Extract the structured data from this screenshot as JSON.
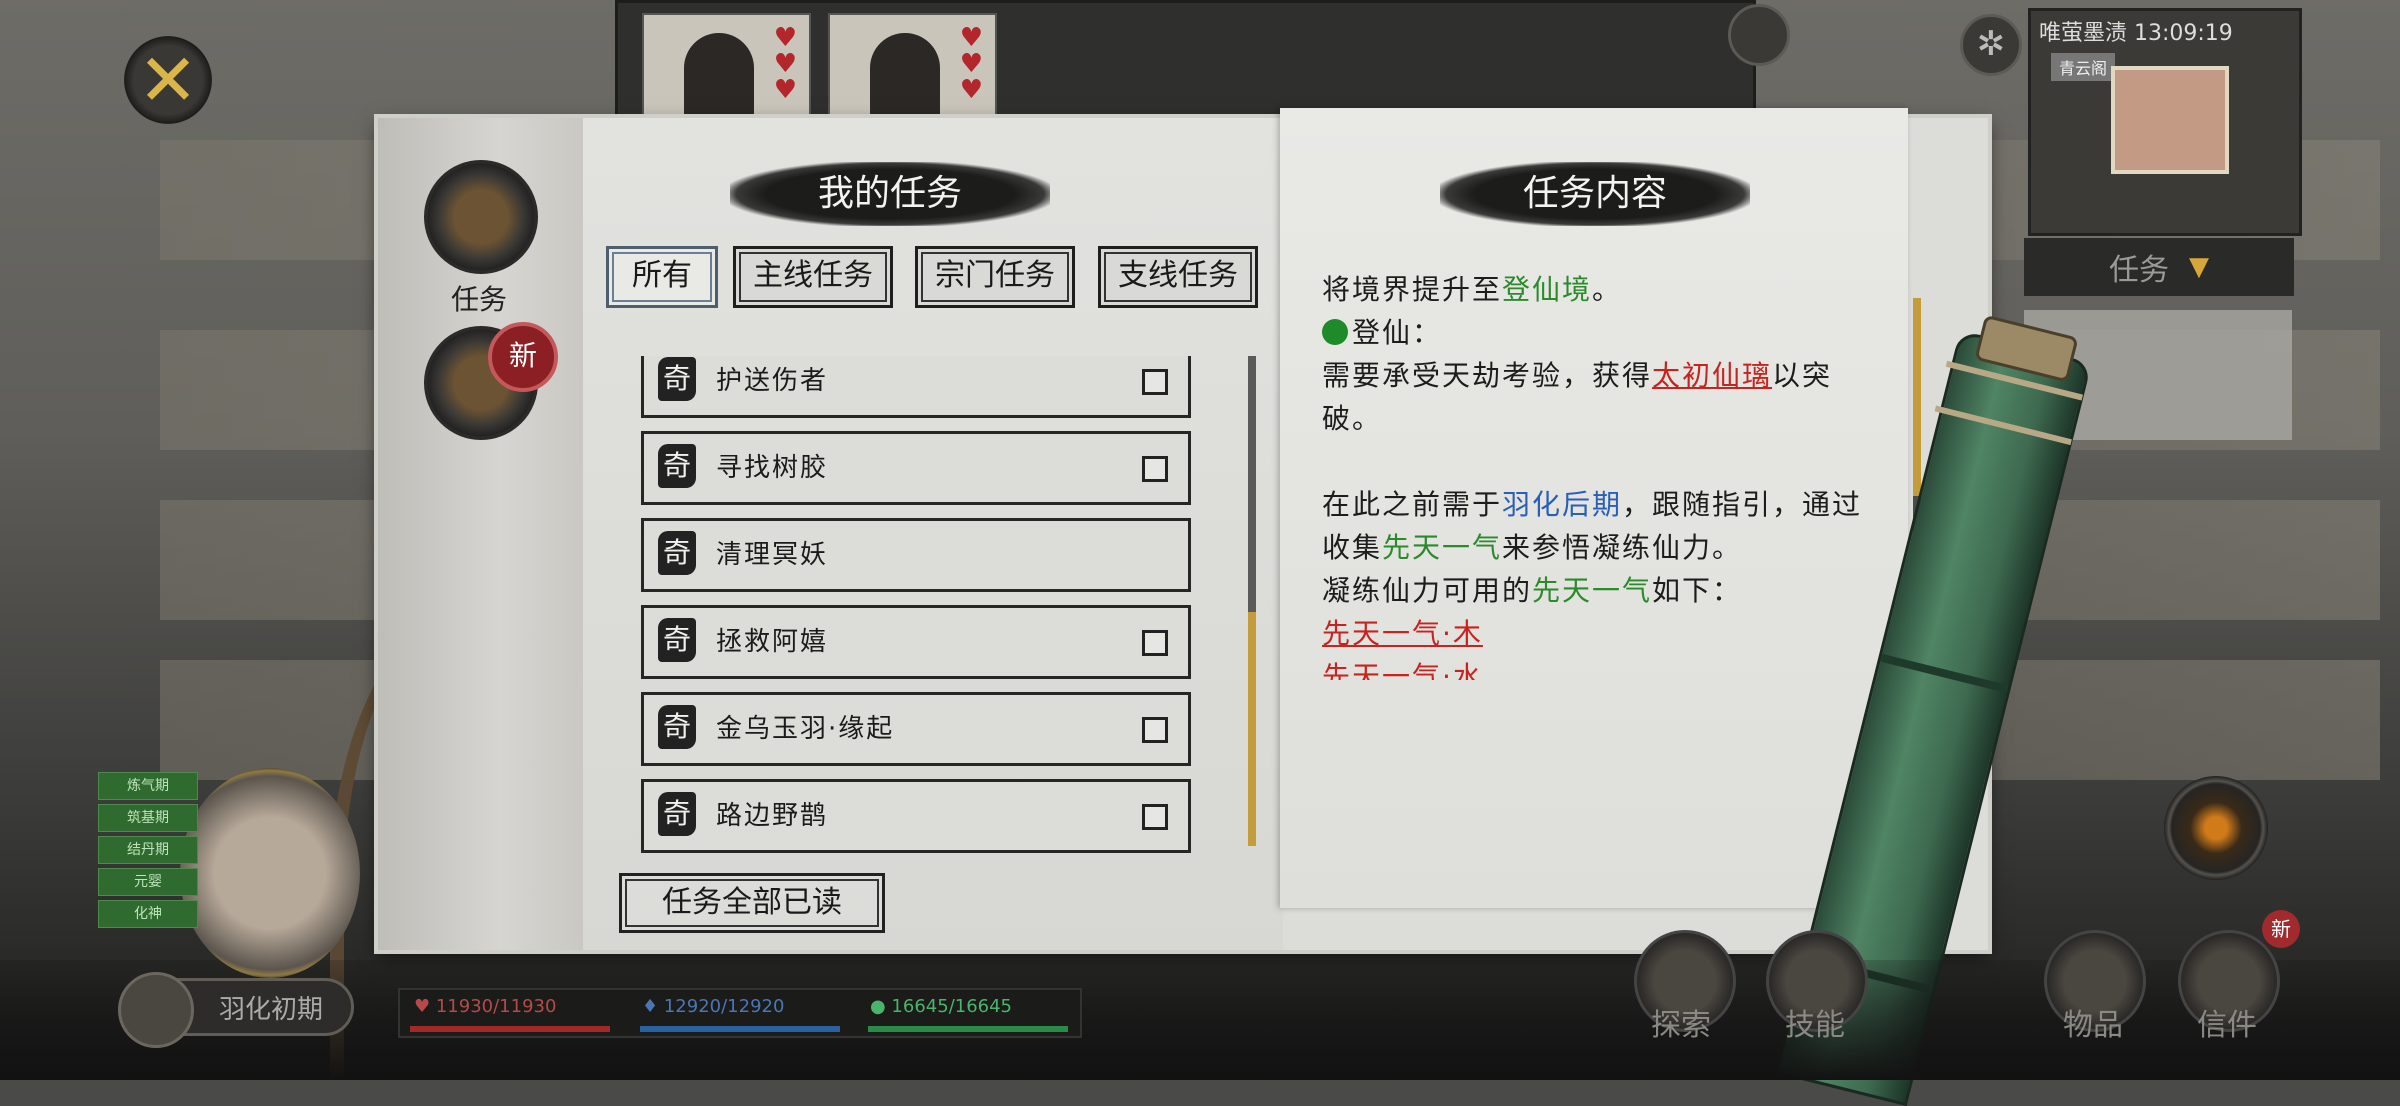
{
  "close_label": "✕",
  "top": {
    "minimap_clock": "唯萤墨渍 13:09:19",
    "minimap_location": "青云阁"
  },
  "task_dropdown": "任务",
  "sidebar": {
    "task_label": "任务",
    "new_badge": "新"
  },
  "left_page": {
    "title": "我的任务",
    "tabs": [
      "所有",
      "主线任务",
      "宗门任务",
      "支线任务"
    ],
    "active_tab": "所有",
    "tasks": [
      {
        "tag": "奇",
        "name": "护送伤者",
        "checkbox": true
      },
      {
        "tag": "奇",
        "name": "寻找树胶",
        "checkbox": true
      },
      {
        "tag": "奇",
        "name": "清理冥妖",
        "checkbox": false
      },
      {
        "tag": "奇",
        "name": "拯救阿嬉",
        "checkbox": true
      },
      {
        "tag": "奇",
        "name": "金乌玉羽·缘起",
        "checkbox": true
      },
      {
        "tag": "奇",
        "name": "路边野鹊",
        "checkbox": true
      }
    ],
    "read_all_button": "任务全部已读"
  },
  "right_page": {
    "title": "任务内容",
    "line1_pre": "将境界提升至",
    "line1_hl": "登仙境",
    "line1_post": "。",
    "line2": "登仙：",
    "line3_pre": "需要承受天劫考验，获得",
    "line3_hl": "太初仙璃",
    "line3_post": "以突破。",
    "line4_pre": "在此之前需于",
    "line4_hl": "羽化后期",
    "line4_post": "，跟随指引，通过",
    "line5_pre": "收集",
    "line5_hl": "先天一气",
    "line5_post": "来参悟凝练仙力。",
    "line6_pre": "凝练仙力可用的",
    "line6_hl": "先天一气",
    "line6_post": "如下：",
    "line7": "先天一气·木",
    "line8": "先天一气·水"
  },
  "hud": {
    "status_buttons": [
      "炼气期",
      "筑基期",
      "结丹期",
      "元婴",
      "化神"
    ],
    "realm": "羽化初期",
    "hp": "♥ 11930/11930",
    "mp": "♦ 12920/12920",
    "sp": "● 16645/16645",
    "nav": [
      "探索",
      "技能",
      "物品",
      "信件"
    ],
    "mail_badge": "新"
  },
  "colors": {
    "accent_gold": "#c39c3c",
    "green_text": "#2c8a2c",
    "blue_text": "#2a5fb8",
    "red_text": "#c9231f",
    "badge_red": "#8c1f23"
  }
}
